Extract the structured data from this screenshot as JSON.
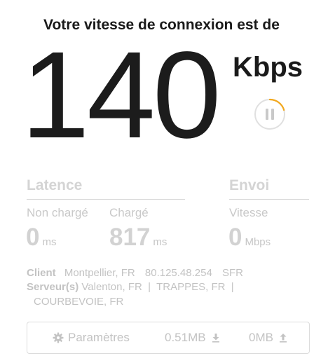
{
  "header": {
    "title": "Votre vitesse de connexion est de"
  },
  "speed": {
    "value": "140",
    "unit": "Kbps",
    "pause_icon": "pause-icon",
    "accent_color": "#f2a81d"
  },
  "latency": {
    "title": "Latence",
    "unloaded_label": "Non chargé",
    "unloaded_value": "0",
    "unloaded_unit": "ms",
    "loaded_label": "Chargé",
    "loaded_value": "817",
    "loaded_unit": "ms"
  },
  "upload": {
    "title": "Envoi",
    "speed_label": "Vitesse",
    "speed_value": "0",
    "speed_unit": "Mbps"
  },
  "client": {
    "label": "Client",
    "location": "Montpellier, FR",
    "ip": "80.125.48.254",
    "isp": "SFR"
  },
  "servers": {
    "label": "Serveur(s)",
    "line1": "Valenton, FR  |  TRAPPES, FR  |",
    "line2": "COURBEVOIE, FR"
  },
  "footer": {
    "settings_icon": "gear-icon",
    "settings_label": "Paramètres",
    "download_total": "0.51MB",
    "download_icon": "download-icon",
    "upload_total": "0MB",
    "upload_icon": "upload-icon"
  }
}
